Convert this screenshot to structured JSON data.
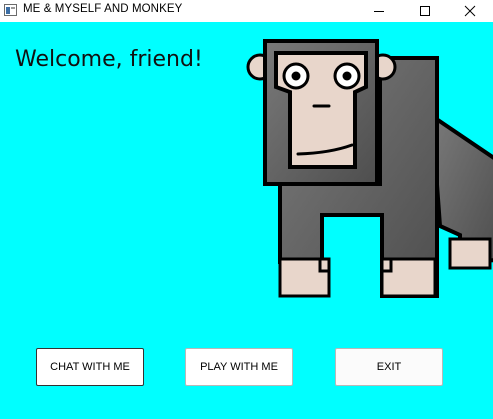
{
  "window": {
    "title": "ME & MYSELF AND MONKEY",
    "minimize_glyph": "minimize-icon",
    "maximize_glyph": "maximize-icon",
    "close_glyph": "close-icon"
  },
  "main": {
    "welcome_text": "Welcome, friend!",
    "background_color": "#00ffff"
  },
  "monkey": {
    "icon": "monkey-illustration",
    "body_color": "#666666",
    "face_color": "#e8d6cb",
    "outline_color": "#000000"
  },
  "buttons": {
    "chat_label": "CHAT WITH ME",
    "play_label": "PLAY WITH ME",
    "exit_label": "EXIT"
  }
}
